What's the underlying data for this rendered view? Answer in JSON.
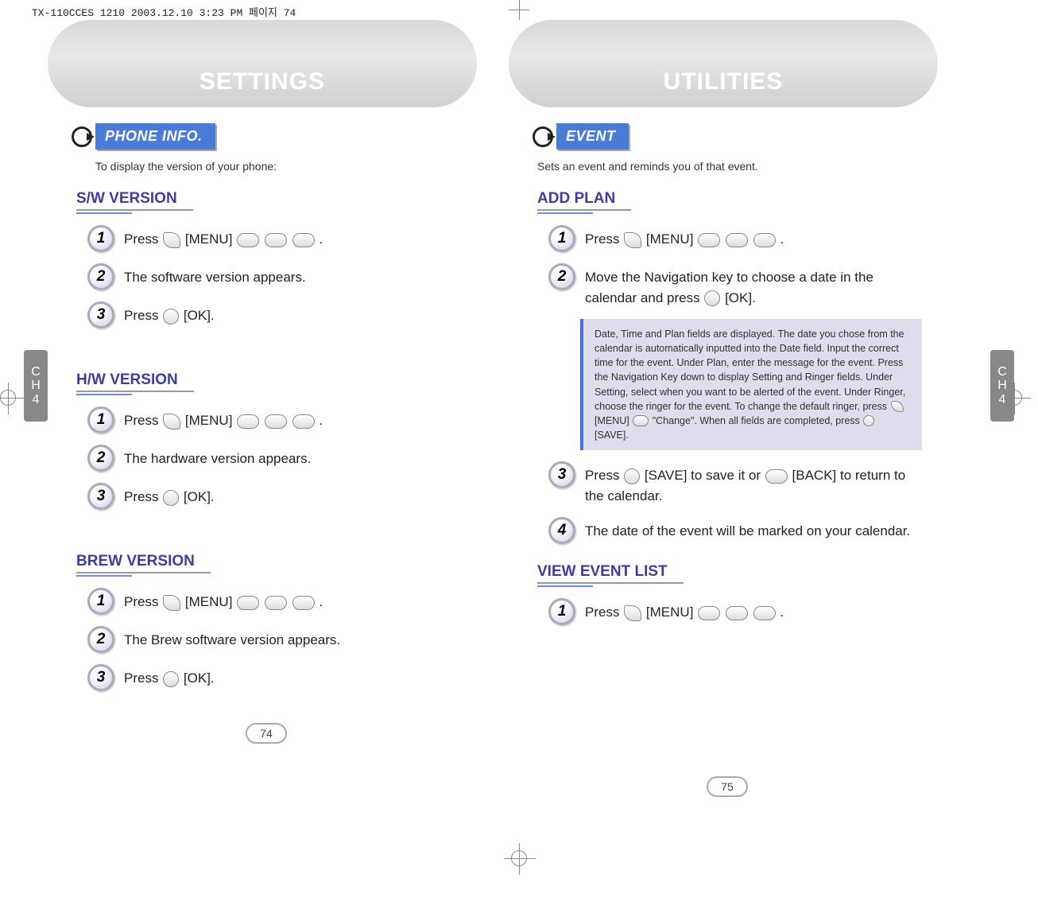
{
  "meta": {
    "header_line": "TX-110CCES 1210  2003.12.10 3:23 PM  페이지 74"
  },
  "side_tab": {
    "ch": "C\nH",
    "num": "4"
  },
  "left_page": {
    "title": "SETTINGS",
    "section_label": "PHONE INFO.",
    "section_desc": "To display the version of your phone:",
    "sw": {
      "heading": "S/W VERSION",
      "step1_a": "Press ",
      "step1_b": " [MENU] ",
      "step1_c": ".",
      "step2": "The software version appears.",
      "step3_a": "Press ",
      "step3_b": " [OK]."
    },
    "hw": {
      "heading": "H/W VERSION",
      "step1_a": "Press ",
      "step1_b": " [MENU] ",
      "step1_c": ".",
      "step2": "The hardware version appears.",
      "step3_a": "Press ",
      "step3_b": " [OK]."
    },
    "brew": {
      "heading": "BREW VERSION",
      "step1_a": "Press ",
      "step1_b": " [MENU] ",
      "step1_c": ".",
      "step2": "The Brew software version appears.",
      "step3_a": "Press ",
      "step3_b": " [OK]."
    },
    "page_number": "74"
  },
  "right_page": {
    "title": "UTILITIES",
    "section_label": "EVENT",
    "section_desc": "Sets an event and reminds you of that event.",
    "add_plan": {
      "heading": "ADD PLAN",
      "step1_a": "Press ",
      "step1_b": " [MENU] ",
      "step1_c": ".",
      "step2_a": "Move the Navigation key to choose a date in the calendar and press ",
      "step2_b": " [OK].",
      "note_a": "Date, Time and Plan fields are displayed. The date you chose from the calendar is automatically inputted into the Date field. Input the correct time for the event. Under Plan, enter the message for the event. Press the Navigation Key down to display Setting and Ringer fields. Under Setting, select when you want to be alerted of the event. Under Ringer, choose the ringer for the event. To change the default ringer, press ",
      "note_b": " [MENU] ",
      "note_c": " \"Change\". When all fields are completed, press ",
      "note_d": " [SAVE].",
      "step3_a": "Press ",
      "step3_b": " [SAVE] to save it or ",
      "step3_c": " [BACK] to return to the calendar.",
      "step4": "The date of the event will be marked on your calendar."
    },
    "view_list": {
      "heading": "VIEW EVENT LIST",
      "step1_a": "Press ",
      "step1_b": " [MENU] ",
      "step1_c": "."
    },
    "page_number": "75"
  }
}
